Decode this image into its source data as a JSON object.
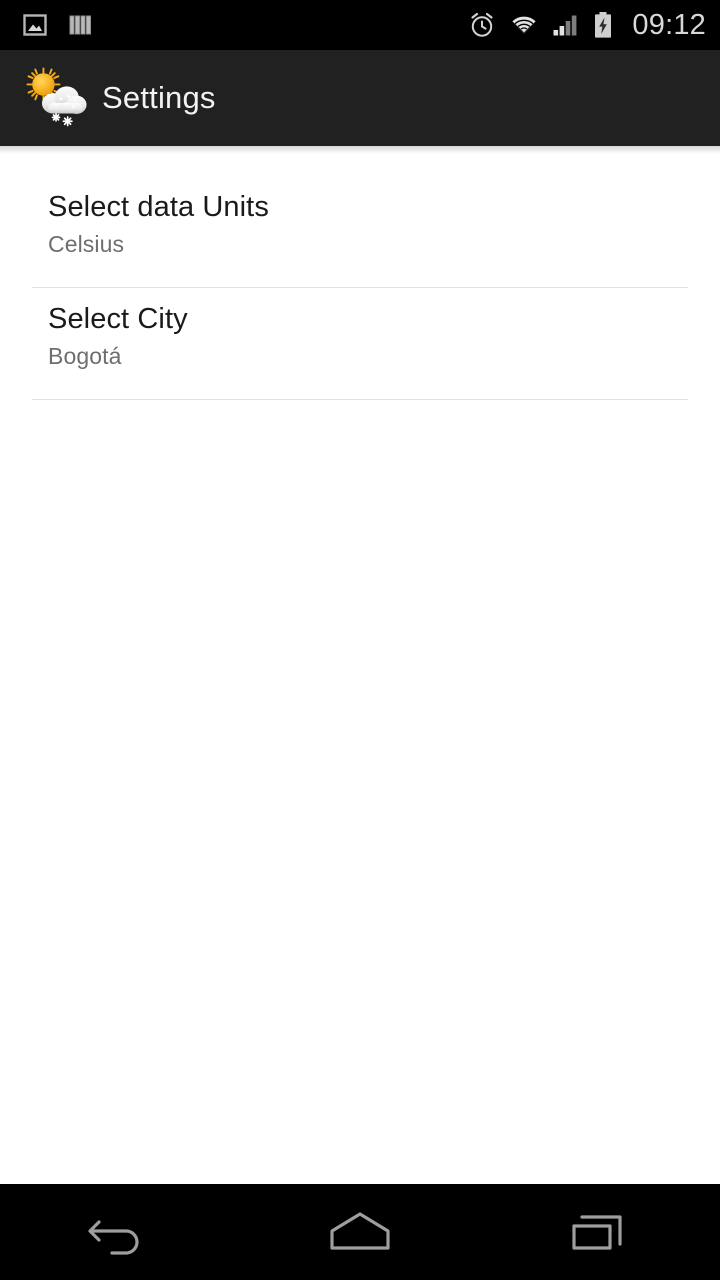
{
  "status_bar": {
    "left_icons": [
      {
        "name": "screenshot-image-icon",
        "label": "screenshot-notification"
      },
      {
        "name": "stripes-books-icon",
        "label": "app-notification"
      }
    ],
    "right_icons": [
      {
        "name": "alarm-clock-icon",
        "label": "alarm set"
      },
      {
        "name": "wifi-icon",
        "label": "wifi connected"
      },
      {
        "name": "cellular-signal-icon",
        "label": "signal 2 of 4 bars"
      },
      {
        "name": "battery-charging-icon",
        "label": "battery charging"
      }
    ],
    "clock": "09:12",
    "background_color": "#000000",
    "text_color": "#d8d8d8"
  },
  "action_bar": {
    "icon_name": "sun-cloud-snow-weather-icon",
    "title": "Settings",
    "background_color": "#212121",
    "title_color": "#f2f2f2",
    "icon_colors": {
      "sun": "#f5a623",
      "sun_light": "#ffd24d",
      "cloud": "#efefef",
      "cloud_shade": "#cfcfcf",
      "snow": "#ffffff"
    }
  },
  "preferences": [
    {
      "key": "units",
      "title": "Select data Units",
      "summary": "Celsius"
    },
    {
      "key": "city",
      "title": "Select City",
      "summary": "Bogotá"
    }
  ],
  "nav_bar": {
    "background_color": "#000000",
    "icon_color": "#9e9e9e",
    "buttons": [
      {
        "name": "nav-back-button",
        "label": "Back"
      },
      {
        "name": "nav-home-button",
        "label": "Home"
      },
      {
        "name": "nav-recents-button",
        "label": "Recent apps"
      }
    ]
  },
  "theme": {
    "page_background": "#ffffff",
    "divider_color": "#e2e2e2",
    "primary_text": "#1a1a1a",
    "secondary_text": "#6e6e6e"
  }
}
